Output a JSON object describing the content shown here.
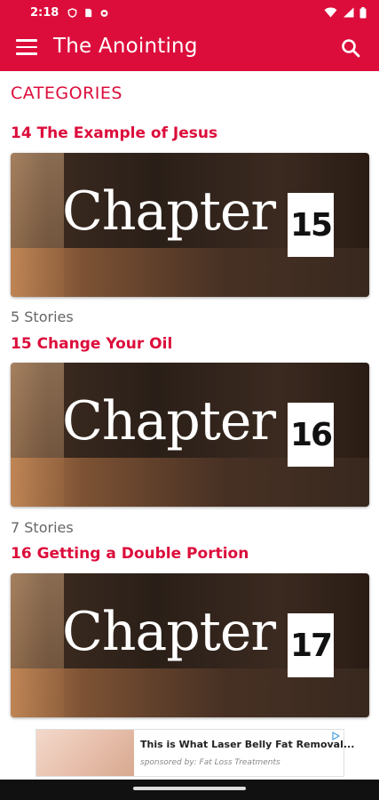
{
  "status": {
    "time": "2:18"
  },
  "appbar": {
    "title": "The Anointing"
  },
  "section": {
    "title": "CATEGORIES"
  },
  "categories": [
    {
      "title": "14 The Example of Jesus",
      "image_word": "Chapter",
      "image_number": "15",
      "stories": "5 Stories"
    },
    {
      "title": "15 Change Your Oil",
      "image_word": "Chapter",
      "image_number": "16",
      "stories": "7 Stories"
    },
    {
      "title": "16 Getting a Double Portion",
      "image_word": "Chapter",
      "image_number": "17"
    }
  ],
  "ad": {
    "headline": "This is What Laser Belly Fat Removal...",
    "sponsor": "sponsored by: Fat Loss Treatments"
  },
  "colors": {
    "accent": "#dc0d3b"
  }
}
